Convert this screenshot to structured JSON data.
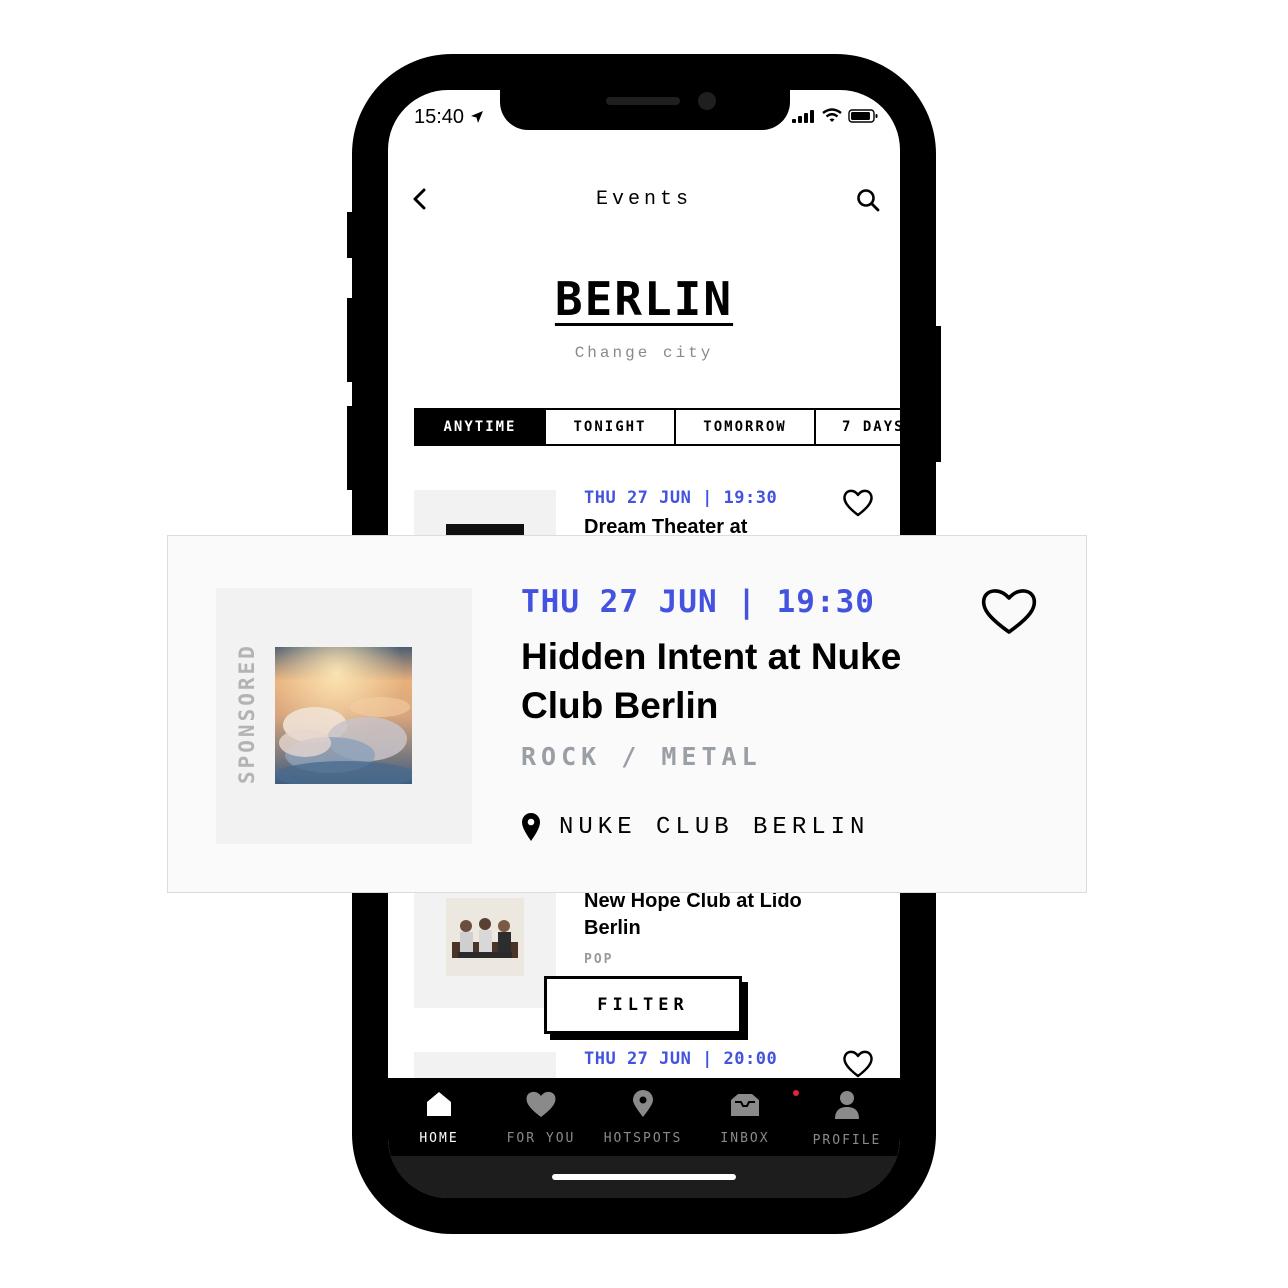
{
  "status_bar": {
    "time": "15:40"
  },
  "header": {
    "title": "Events"
  },
  "city": {
    "name": "BERLIN",
    "change_label": "Change city"
  },
  "tabs": [
    {
      "label": "ANYTIME",
      "active": true
    },
    {
      "label": "TONIGHT",
      "active": false
    },
    {
      "label": "TOMORROW",
      "active": false
    },
    {
      "label": "7 DAYS",
      "active": false
    }
  ],
  "events": [
    {
      "date": "THU 27 JUN | 19:30",
      "title": "Dream Theater at"
    },
    {
      "title": "New Hope Club at Lido Berlin",
      "genre": "POP"
    },
    {
      "date": "THU 27 JUN | 20:00"
    }
  ],
  "featured_card": {
    "sponsored_label": "SPONSORED",
    "date": "THU 27 JUN | 19:30",
    "title": "Hidden Intent at Nuke Club Berlin",
    "genre": "ROCK / METAL",
    "venue": "NUKE CLUB BERLIN"
  },
  "filter_button": {
    "label": "FILTER"
  },
  "bottom_nav": [
    {
      "label": "HOME",
      "icon": "home-icon",
      "active": true
    },
    {
      "label": "FOR YOU",
      "icon": "heart-icon",
      "active": false
    },
    {
      "label": "HOTSPOTS",
      "icon": "map-pin-icon",
      "active": false
    },
    {
      "label": "INBOX",
      "icon": "inbox-icon",
      "active": false,
      "has_notification": true
    },
    {
      "label": "PROFILE",
      "icon": "person-icon",
      "active": false
    }
  ],
  "colors": {
    "accent": "#4353e0",
    "genre": "#9a9fa6",
    "notification": "#e8213a"
  }
}
